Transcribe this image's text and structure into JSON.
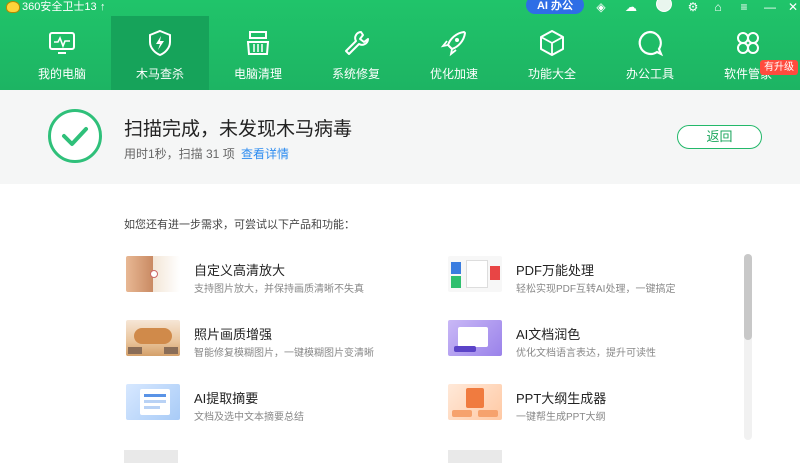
{
  "app": {
    "title": "360安全卫士13",
    "update_icon": "arrow-up-icon",
    "ai_office": "AI 办公",
    "colors": {
      "brand_green": "#1fbd66",
      "active_tab": "#16a35a",
      "link_blue": "#2d8cf0"
    }
  },
  "nav": {
    "items": [
      {
        "label": "我的电脑",
        "icon": "monitor-icon"
      },
      {
        "label": "木马查杀",
        "icon": "shield-icon",
        "active": true
      },
      {
        "label": "电脑清理",
        "icon": "broom-icon"
      },
      {
        "label": "系统修复",
        "icon": "wrench-icon"
      },
      {
        "label": "优化加速",
        "icon": "rocket-icon"
      },
      {
        "label": "功能大全",
        "icon": "cube-icon"
      },
      {
        "label": "办公工具",
        "icon": "chat-bubble-icon"
      },
      {
        "label": "软件管家",
        "icon": "apps-icon"
      }
    ],
    "software_badge": "有升级"
  },
  "result": {
    "title": "扫描完成，未发现木马病毒",
    "meta": "用时1秒，扫描 31 项",
    "details_link": "查看详情",
    "back_button": "返回"
  },
  "suggestions": {
    "title": "如您还有进一步需求，可尝试以下产品和功能：",
    "items": [
      {
        "title": "自定义高清放大",
        "desc": "支持图片放大，并保持画质清晰不失真"
      },
      {
        "title": "PDF万能处理",
        "desc": "轻松实现PDF互转AI处理，一键搞定"
      },
      {
        "title": "照片画质增强",
        "desc": "智能修复模糊图片，一键模糊图片变清晰"
      },
      {
        "title": "AI文档润色",
        "desc": "优化文档语言表达，提升可读性"
      },
      {
        "title": "AI提取摘要",
        "desc": "文档及选中文本摘要总结"
      },
      {
        "title": "PPT大纲生成器",
        "desc": "一键帮生成PPT大纲"
      }
    ]
  }
}
